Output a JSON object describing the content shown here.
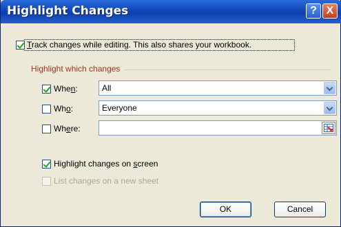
{
  "dialog": {
    "title": "Highlight Changes",
    "help_label": "?",
    "close_label": "X"
  },
  "track_changes": {
    "checked": true,
    "pre": "",
    "accel": "T",
    "post": "rack changes while editing. This also shares your workbook."
  },
  "group": {
    "label": "Highlight which changes"
  },
  "when": {
    "checked": true,
    "pre": "Whe",
    "accel": "n",
    "post": ":",
    "value": "All"
  },
  "who": {
    "checked": false,
    "pre": "Wh",
    "accel": "o",
    "post": ":",
    "value": "Everyone"
  },
  "where": {
    "checked": false,
    "pre": "Wh",
    "accel": "e",
    "post": "re:",
    "value": ""
  },
  "highlight_on_screen": {
    "checked": true,
    "pre": "Highlight changes on ",
    "accel": "s",
    "post": "creen"
  },
  "list_changes": {
    "checked": false,
    "enabled": false,
    "label": "List changes on a new sheet"
  },
  "buttons": {
    "ok": "OK",
    "cancel": "Cancel"
  }
}
